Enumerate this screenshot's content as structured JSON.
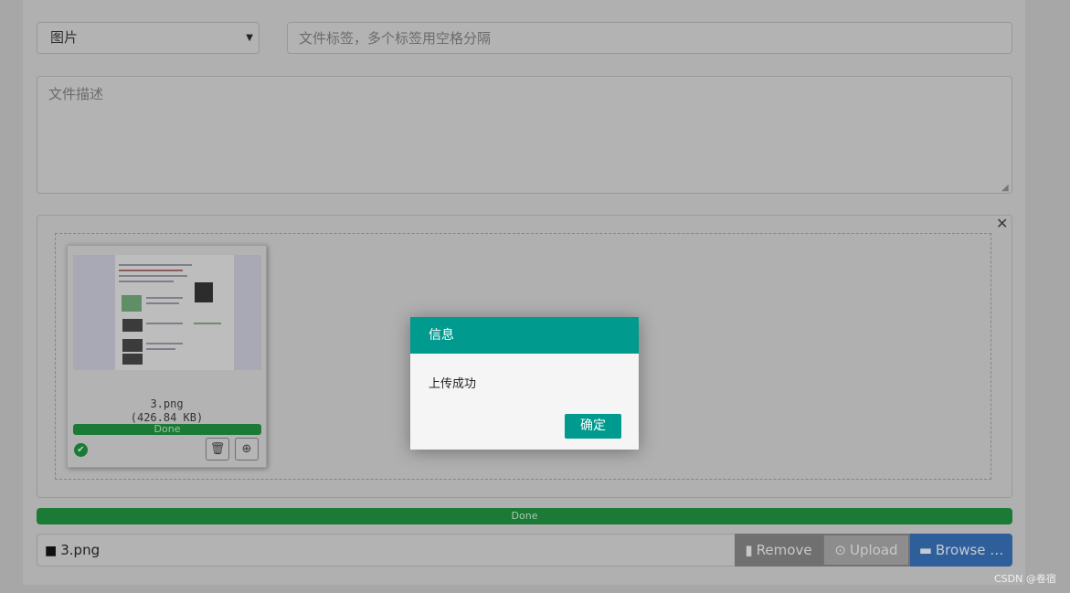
{
  "form": {
    "category_select": {
      "selected": "图片"
    },
    "tags_input": {
      "placeholder": "文件标签，多个标签用空格分隔"
    },
    "description": {
      "placeholder": "文件描述"
    }
  },
  "upload": {
    "thumbnail": {
      "filename": "3.png",
      "filesize": "(426.84 KB)",
      "progress_label": "Done",
      "progress": 1.0
    },
    "overall_progress": {
      "label": "Done",
      "progress": 1.0
    },
    "caption": "3.png",
    "buttons": {
      "remove": "Remove",
      "upload": "Upload",
      "browse": "Browse …"
    }
  },
  "dialog": {
    "title": "信息",
    "message": "上传成功",
    "ok": "确定"
  },
  "watermark": "CSDN @卷宿",
  "colors": {
    "accent_teal": "#009a8f",
    "success_green": "#1b7a36",
    "browse_blue": "#2f5f9b"
  }
}
